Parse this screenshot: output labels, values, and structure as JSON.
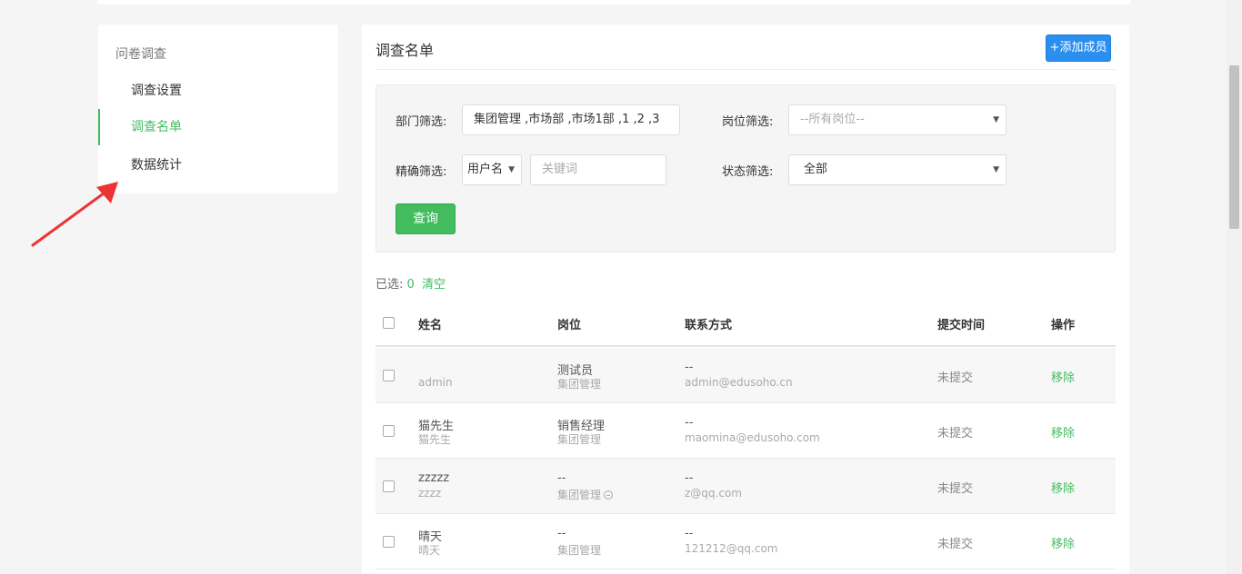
{
  "sidebar": {
    "heading": "问卷调查",
    "items": [
      {
        "label": "调查设置",
        "active": false
      },
      {
        "label": "调查名单",
        "active": true
      },
      {
        "label": "数据统计",
        "active": false
      }
    ]
  },
  "main": {
    "title": "调查名单",
    "add_button": "+添加成员"
  },
  "filter": {
    "dept_label": "部门筛选:",
    "dept_value": "集团管理 ,市场部 ,市场1部 ,1 ,2 ,3",
    "post_label": "岗位筛选:",
    "post_value": "--所有岗位--",
    "exact_label": "精确筛选:",
    "exact_type": "用户名",
    "keyword_placeholder": "关键词",
    "status_label": "状态筛选:",
    "status_value": "全部",
    "query_button": "查询"
  },
  "selection": {
    "label": "已选:",
    "count": "0",
    "clear": "清空"
  },
  "table": {
    "headers": {
      "name": "姓名",
      "post": "岗位",
      "contact": "联系方式",
      "submit_time": "提交时间",
      "action": "操作"
    },
    "rows": [
      {
        "name": "",
        "username": "admin",
        "post": "测试员",
        "dept": "集团管理",
        "phone": "--",
        "email": "admin@edusoho.cn",
        "status": "未提交",
        "action": "移除"
      },
      {
        "name": "猫先生",
        "username": "猫先生",
        "post": "销售经理",
        "dept": "集团管理",
        "phone": "--",
        "email": "maomina@edusoho.com",
        "status": "未提交",
        "action": "移除"
      },
      {
        "name": "zzzzz",
        "username": "zzzz",
        "post": "--",
        "dept": "集团管理",
        "phone": "--",
        "email": "z@qq.com",
        "status": "未提交",
        "action": "移除"
      },
      {
        "name": "晴天",
        "username": "晴天",
        "post": "--",
        "dept": "集团管理",
        "phone": "--",
        "email": "121212@qq.com",
        "status": "未提交",
        "action": "移除"
      }
    ]
  },
  "colors": {
    "accent_green": "#43bc60",
    "primary_blue": "#2b8ff0",
    "annotation_red": "#ee3333"
  }
}
